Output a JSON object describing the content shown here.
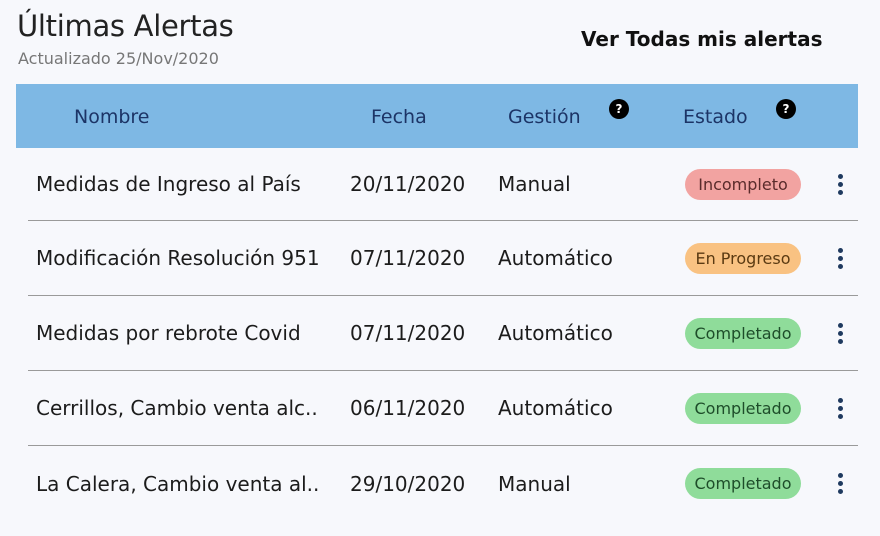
{
  "header": {
    "title": "Últimas Alertas",
    "subtitle": "Actualizado 25/Nov/2020",
    "view_all_label": "Ver Todas mis alertas"
  },
  "table": {
    "columns": {
      "nombre": "Nombre",
      "fecha": "Fecha",
      "gestion": "Gestión",
      "estado": "Estado"
    },
    "help_glyph": "?",
    "rows": [
      {
        "nombre": "Medidas de Ingreso al País",
        "fecha": "20/11/2020",
        "gestion": "Manual",
        "estado": "Incompleto",
        "estado_color": "#f2a3a1"
      },
      {
        "nombre": "Modificación Resolución 951",
        "fecha": "07/11/2020",
        "gestion": "Automático",
        "estado": "En Progreso",
        "estado_color": "#f9c282"
      },
      {
        "nombre": "Medidas por rebrote Covid",
        "fecha": "07/11/2020",
        "gestion": "Automático",
        "estado": "Completado",
        "estado_color": "#8fdc9a"
      },
      {
        "nombre": "Cerrillos, Cambio venta alc..",
        "fecha": "06/11/2020",
        "gestion": "Automático",
        "estado": "Completado",
        "estado_color": "#8fdc9a"
      },
      {
        "nombre": "La Calera, Cambio venta al..",
        "fecha": "29/10/2020",
        "gestion": "Manual",
        "estado": "Completado",
        "estado_color": "#8fdc9a"
      }
    ]
  },
  "colors": {
    "header_bg": "#7eb8e4",
    "header_text": "#1c3466",
    "menu_icon": "#1f3a5f"
  },
  "icons": {
    "help": "question-circle-icon",
    "row_menu": "more-vertical-icon"
  }
}
